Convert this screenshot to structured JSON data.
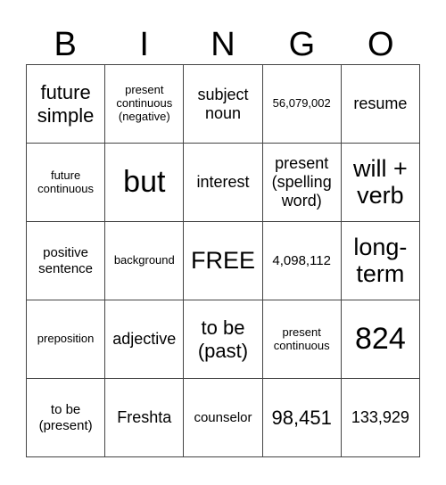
{
  "header": {
    "letters": [
      "B",
      "I",
      "N",
      "G",
      "O"
    ]
  },
  "board": {
    "rows": [
      [
        "future simple",
        "present continuous (negative)",
        "subject noun",
        "56,079,002",
        "resume"
      ],
      [
        "future continuous",
        "but",
        "interest",
        "present (spelling word)",
        "will + verb"
      ],
      [
        "positive sentence",
        "background",
        "FREE",
        "4,098,112",
        "long-term"
      ],
      [
        "preposition",
        "adjective",
        "to be (past)",
        "present continuous",
        "824"
      ],
      [
        "to be (present)",
        "Freshta",
        "counselor",
        "98,451",
        "133,929"
      ]
    ],
    "free_space": {
      "row": 2,
      "col": 2,
      "label": "FREE"
    }
  }
}
